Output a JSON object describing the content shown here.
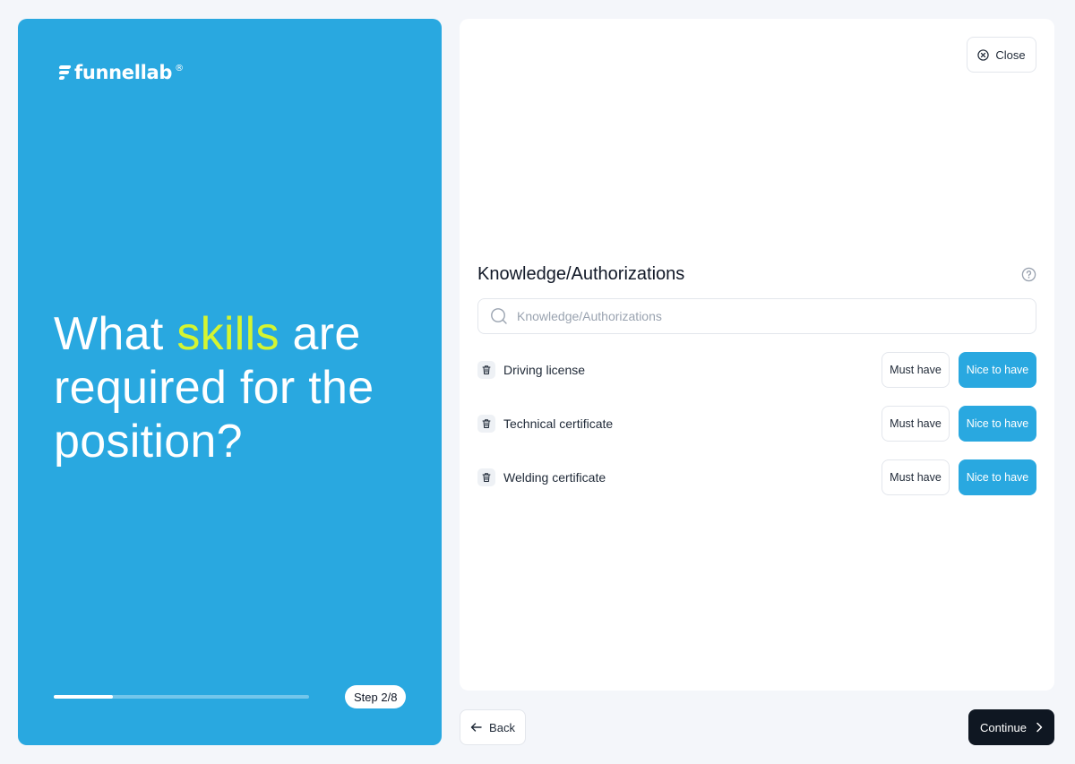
{
  "brand": {
    "name": "funnellab",
    "registered": "®"
  },
  "hero": {
    "headline_before": "What ",
    "headline_highlight": "skills",
    "headline_after": " are required for the position?",
    "highlight_color": "#d4f531",
    "background_color": "#29a8e0",
    "progress_fraction": 0.23,
    "step_label": "Step 2/8"
  },
  "card": {
    "close_label": "Close",
    "section_title": "Knowledge/Authorizations",
    "search": {
      "placeholder": "Knowledge/Authorizations",
      "value": ""
    },
    "skills": [
      {
        "label": "Driving license",
        "must_label": "Must have",
        "nice_label": "Nice to have",
        "selected": "nice"
      },
      {
        "label": "Technical certificate",
        "must_label": "Must have",
        "nice_label": "Nice to have",
        "selected": "nice"
      },
      {
        "label": "Welding certificate",
        "must_label": "Must have",
        "nice_label": "Nice to have",
        "selected": "nice"
      }
    ]
  },
  "footer": {
    "back_label": "Back",
    "continue_label": "Continue"
  },
  "icons": {
    "close": "close-circle-icon",
    "help": "question-circle-icon",
    "search": "search-icon",
    "trash": "trash-icon",
    "back": "arrow-left-icon",
    "continue": "chevron-right-icon"
  }
}
